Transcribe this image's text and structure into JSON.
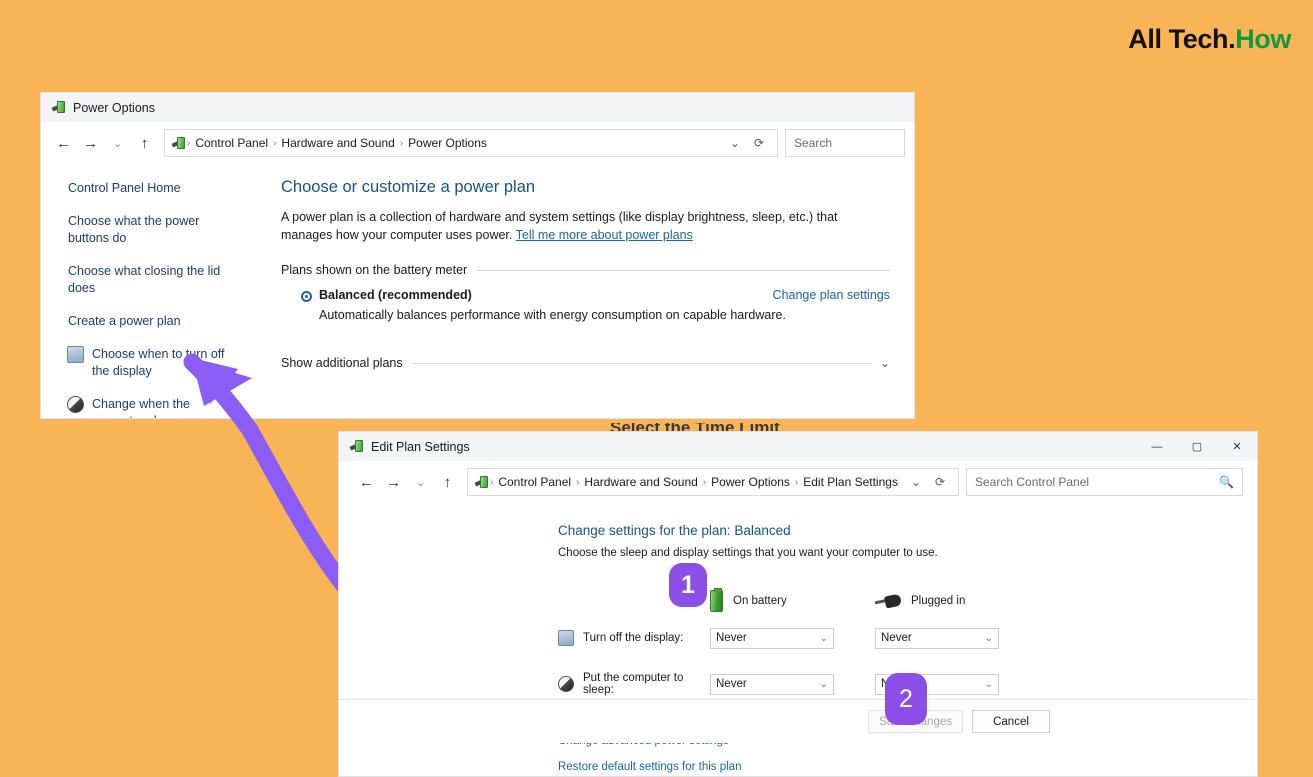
{
  "brand": {
    "dark": "All Tech.",
    "green": "How"
  },
  "power_window": {
    "title": "Power Options",
    "app_icon": "power-options-icon",
    "nav": {
      "back": "←",
      "forward": "→",
      "recent": "⌄",
      "up": "↑",
      "breadcrumbs": [
        "Control Panel",
        "Hardware and Sound",
        "Power Options"
      ],
      "dropdown": "⌄",
      "refresh": "⟳",
      "search_placeholder": "Search"
    },
    "sidebar": [
      {
        "label": "Control Panel Home",
        "icon": null
      },
      {
        "label": "Choose what the power buttons do",
        "icon": null
      },
      {
        "label": "Choose what closing the lid does",
        "icon": null
      },
      {
        "label": "Create a power plan",
        "icon": null
      },
      {
        "label": "Choose when to turn off the display",
        "icon": "monitor-icon"
      },
      {
        "label": "Change when the computer sleeps",
        "icon": "moon-icon"
      }
    ],
    "main": {
      "heading": "Choose or customize a power plan",
      "paragraph": "A power plan is a collection of hardware and system settings (like display brightness, sleep, etc.) that manages how your computer uses power.",
      "link": "Tell me more about power plans",
      "group_label": "Plans shown on the battery meter",
      "plan_name": "Balanced (recommended)",
      "plan_action": "Change plan settings",
      "plan_desc": "Automatically balances performance with energy consumption on capable hardware.",
      "show_additional": "Show additional plans",
      "show_additional_chevron": "⌄"
    }
  },
  "edit_window": {
    "title": "Edit Plan Settings",
    "app_icon": "power-options-icon",
    "controls": {
      "minimize": "—",
      "maximize": "▢",
      "close": "✕"
    },
    "nav": {
      "back": "←",
      "forward": "→",
      "recent": "⌄",
      "up": "↑",
      "breadcrumbs": [
        "Control Panel",
        "Hardware and Sound",
        "Power Options",
        "Edit Plan Settings"
      ],
      "dropdown": "⌄",
      "refresh": "⟳",
      "search_placeholder": "Search Control Panel",
      "search_icon": "magnifier-icon"
    },
    "heading": "Change settings for the plan: Balanced",
    "subheading": "Choose the sleep and display settings that you want your computer to use.",
    "columns": [
      {
        "label": "On battery",
        "icon": "battery-icon"
      },
      {
        "label": "Plugged in",
        "icon": "power-plug-icon"
      }
    ],
    "rows": [
      {
        "label": "Turn off the display:",
        "icon": "monitor-icon",
        "battery_value": "Never",
        "plugged_value": "Never"
      },
      {
        "label": "Put the computer to sleep:",
        "icon": "moon-icon",
        "battery_value": "Never",
        "plugged_value": "Never"
      }
    ],
    "links": [
      "Change advanced power settings",
      "Restore default settings for this plan"
    ],
    "buttons": {
      "save": "Save changes",
      "save_disabled": true,
      "cancel": "Cancel"
    },
    "chevron": "⌄"
  },
  "annotations": {
    "badge_1": "1",
    "badge_2": "2",
    "arrow_color": "#8B5CF6",
    "arrow_target": "Choose when to turn off the display"
  },
  "ghost_text": "Select the Time Limit",
  "colors": {
    "background": "#F8B455",
    "accent_purple": "#8B4FE8",
    "link_blue": "#1962B0",
    "heading_blue": "#16538C",
    "brand_green": "#0E9B42"
  }
}
